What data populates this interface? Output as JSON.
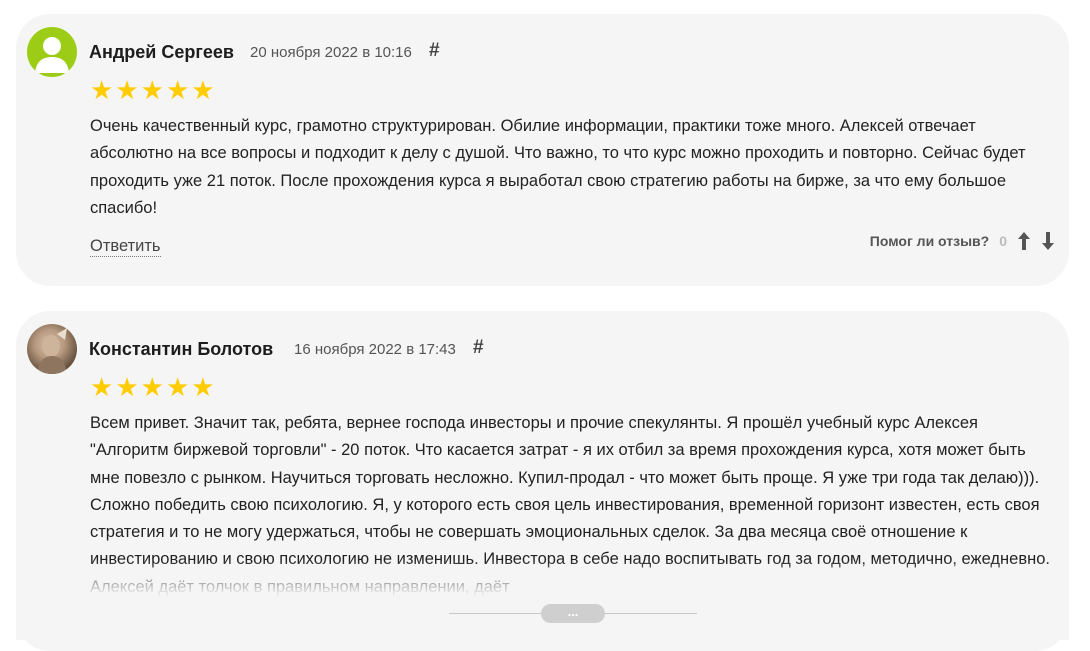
{
  "reviews": [
    {
      "author": "Андрей Сергеев",
      "date": "20 ноября 2022 в 10:16",
      "anchor": "#",
      "stars": 5,
      "text": "Очень качественный курс, грамотно структурирован. Обилие информации, практики тоже много. Алексей отвечает абсолютно на все вопросы и подходит к делу с душой. Что важно, то что курс можно проходить и повторно. Сейчас будет проходить уже 21 поток. После прохождения курса я выработал свою стратегию работы на бирже, за что ему большое спасибо!",
      "reply_label": "Ответить",
      "helpful_label": "Помог ли отзыв?",
      "helpful_count": "0"
    },
    {
      "author": "Константин Болотов",
      "date": "16 ноября 2022 в 17:43",
      "anchor": "#",
      "stars": 5,
      "text": "Всем привет. Значит так, ребята, вернее господа инвесторы и прочие спекулянты. Я прошёл учебный курс Алексея \"Алгоритм биржевой торговли\" - 20 поток. Что касается затрат - я их отбил за время прохождения курса, хотя может быть мне повезло с рынком. Научиться торговать несложно. Купил-продал - что может быть проще. Я уже три года так делаю))). Сложно победить свою психологию. Я, у которого есть своя цель инвестирования, временной горизонт известен, есть своя стратегия и то не могу удержаться, чтобы не совершать эмоциональных сделок. За два месяца своё отношение к инвестированию и свою психологию не изменишь. Инвестора в себе надо воспитывать год за годом, методично, ежедневно. Алексей даёт толчок в правильном направлении, даёт"
    }
  ],
  "more_label": "...",
  "colors": {
    "star": "#ffcc00",
    "card_bg": "#f5f5f5",
    "avatar_green": "#9ccc16"
  },
  "icons": {
    "vote_up": "arrow-up-icon",
    "vote_down": "arrow-down-icon"
  }
}
